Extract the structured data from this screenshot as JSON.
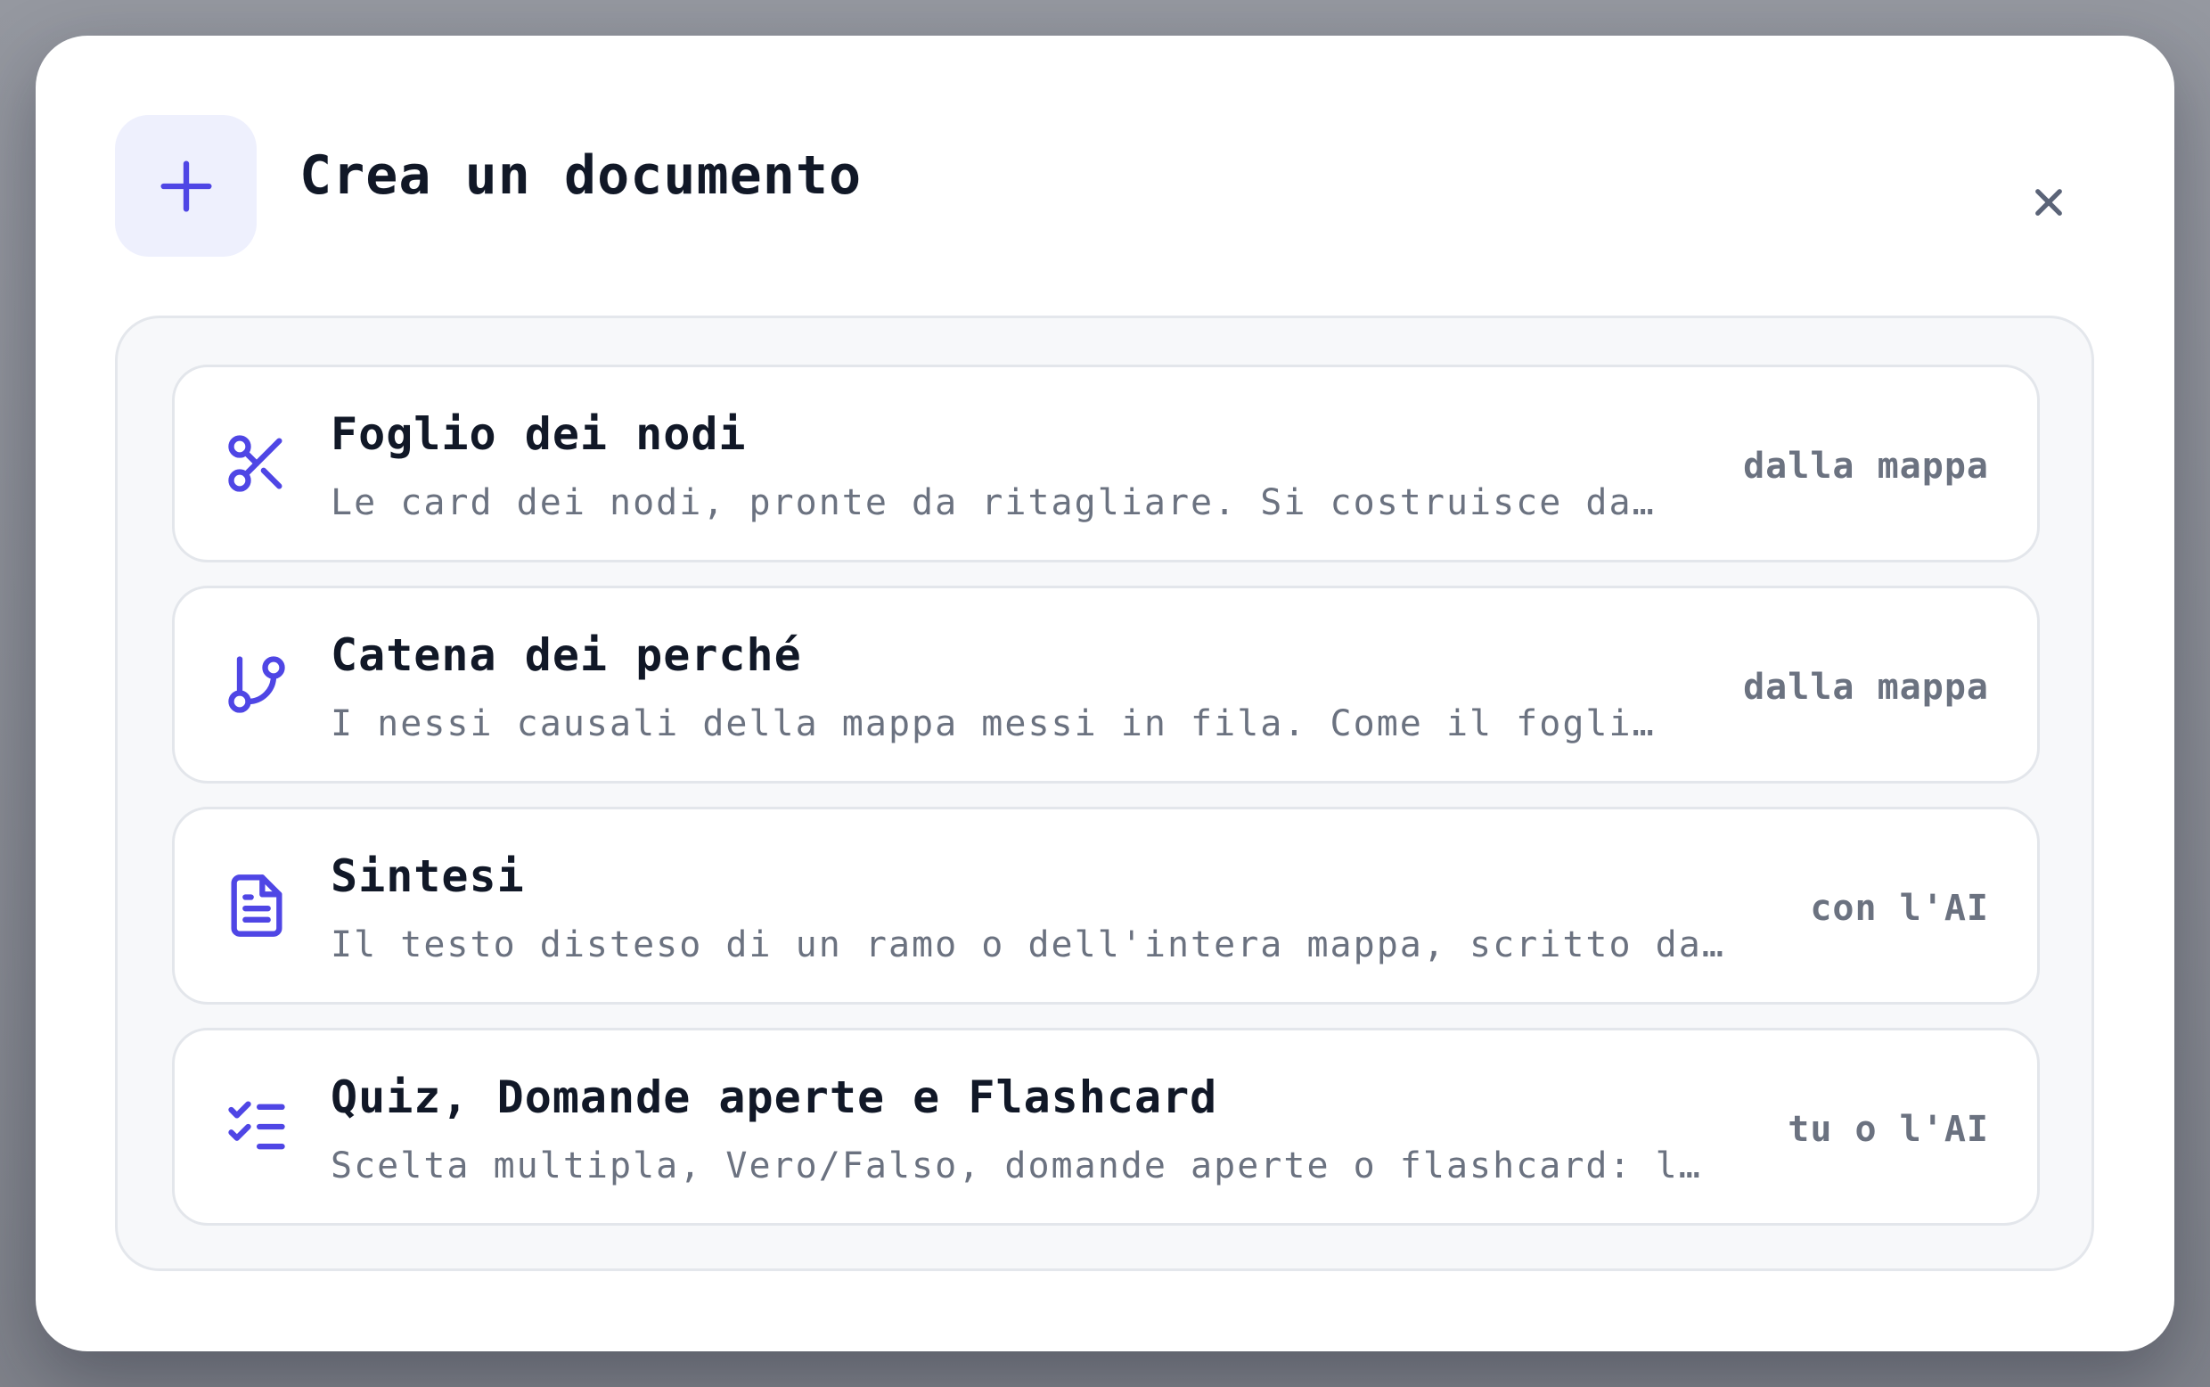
{
  "colors": {
    "accent": "#4f46e5",
    "accent_soft": "#eef0fd",
    "close": "#5b6478"
  },
  "header": {
    "icon": "plus-icon",
    "title": "Crea un documento",
    "close_icon": "close-icon"
  },
  "options": [
    {
      "icon": "scissors-icon",
      "title": "Foglio dei nodi",
      "description": "Le card dei nodi, pronte da ritagliare. Si costruisce da…",
      "tag": "dalla mappa"
    },
    {
      "icon": "git-branch-icon",
      "title": "Catena dei perché",
      "description": "I nessi causali della mappa messi in fila. Come il fogli…",
      "tag": "dalla mappa"
    },
    {
      "icon": "document-text-icon",
      "title": "Sintesi",
      "description": "Il testo disteso di un ramo o dell'intera mappa, scritto da…",
      "tag": "con l'AI"
    },
    {
      "icon": "checklist-icon",
      "title": "Quiz, Domande aperte e Flashcard",
      "description": "Scelta multipla, Vero/Falso, domande aperte o flashcard: l…",
      "tag": "tu o l'AI"
    }
  ]
}
